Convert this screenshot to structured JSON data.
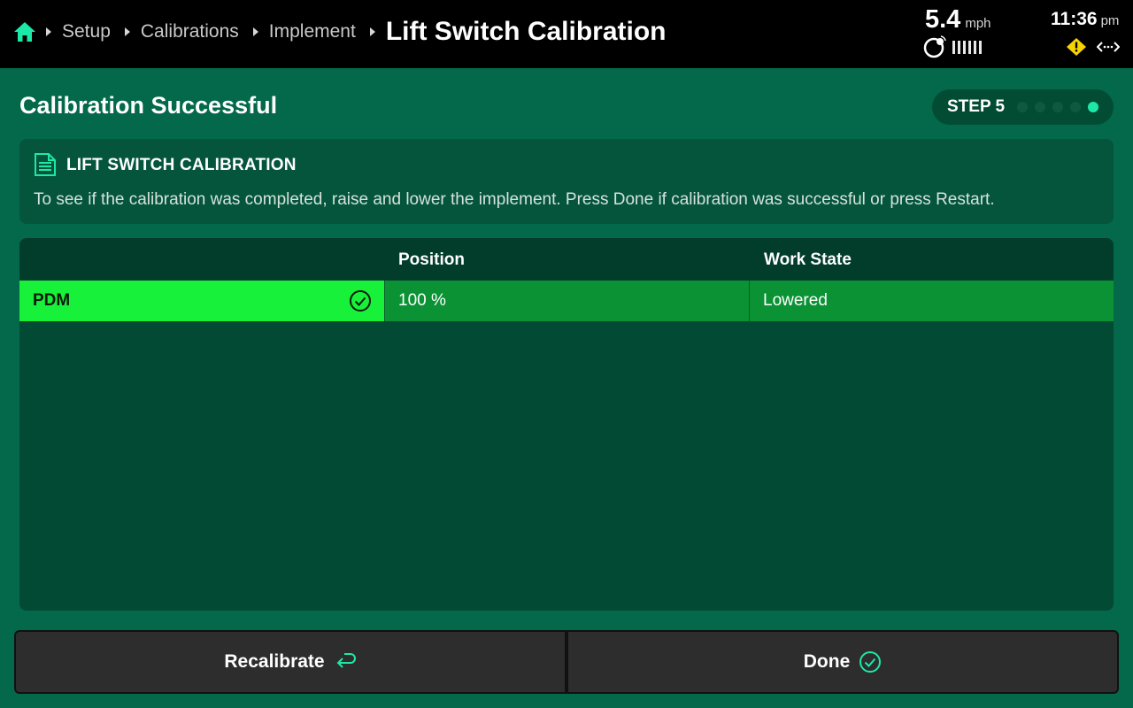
{
  "topbar": {
    "breadcrumbs": [
      "Setup",
      "Calibrations",
      "Implement"
    ],
    "current": "Lift Switch Calibration",
    "speed": "5.4",
    "speed_unit": "mph",
    "time": "11:36",
    "ampm": "pm",
    "icons": [
      "home-icon",
      "gps-icon",
      "signal-bars-icon",
      "warning-icon",
      "connection-icon"
    ]
  },
  "header": {
    "title": "Calibration Successful",
    "step_label": "STEP 5",
    "step_total": 5,
    "step_current": 5
  },
  "info": {
    "title": "LIFT SWITCH CALIBRATION",
    "text": "To see if the calibration was completed, raise and lower the implement. Press Done if calibration was successful or press Restart."
  },
  "table": {
    "columns": [
      "",
      "Position",
      "Work State"
    ],
    "rows": [
      {
        "name": "PDM",
        "position": "100 %",
        "work_state": "Lowered"
      }
    ]
  },
  "buttons": {
    "recalibrate": "Recalibrate",
    "done": "Done"
  },
  "colors": {
    "background": "#03694a",
    "accent": "#1de9a7",
    "row_selected": "#17f13a",
    "row_cell": "#0a9234",
    "warning": "#f5d400"
  }
}
